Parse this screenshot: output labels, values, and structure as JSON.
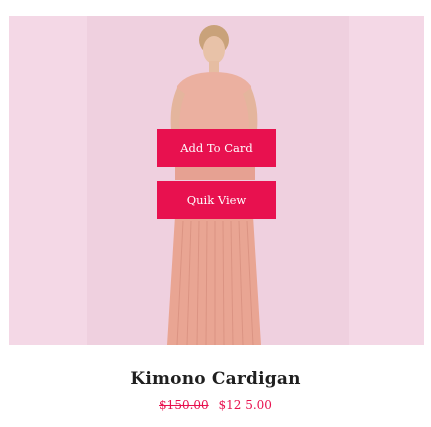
{
  "product": {
    "title": "Kimono Cardigan",
    "price_old": "$150.00",
    "price_new": "$12 5.00",
    "image_name": "model-in-pink-pleated-dress"
  },
  "actions": {
    "add_to_cart_label": "Add To Card",
    "quick_view_label": "Quik View"
  },
  "colors": {
    "accent": "#e8114f",
    "image_background": "#f4d8e6",
    "dress": "#e9a593",
    "title": "#1f1f1f"
  }
}
